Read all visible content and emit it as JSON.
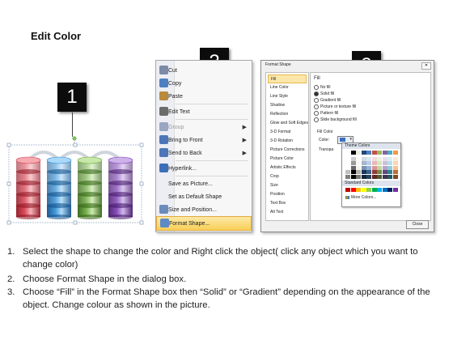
{
  "title": "Edit Color",
  "steps": [
    "1",
    "2",
    "3"
  ],
  "cylinders": {
    "colors": [
      {
        "name": "red",
        "dark": "#8b0f1c",
        "mid": "#d63b4b",
        "light": "#f6aab2"
      },
      {
        "name": "blue",
        "dark": "#0a4a86",
        "mid": "#2f8fd6",
        "light": "#a9d8f8"
      },
      {
        "name": "green",
        "dark": "#2c5e0c",
        "mid": "#6aa83a",
        "light": "#c7e8a8"
      },
      {
        "name": "purple",
        "dark": "#3f1366",
        "mid": "#7d3fb5",
        "light": "#cdb2ea"
      }
    ]
  },
  "context_menu": {
    "items": [
      {
        "label": "Cut",
        "icon": "scissors-icon",
        "color": "#7d8aa8",
        "disabled": false,
        "submenu": false
      },
      {
        "label": "Copy",
        "icon": "copy-icon",
        "color": "#4e7fc0",
        "disabled": false,
        "submenu": false
      },
      {
        "label": "Paste",
        "icon": "paste-icon",
        "color": "#b98a3c",
        "disabled": false,
        "submenu": false
      },
      {
        "label": "Edit Text",
        "icon": "edit-text-icon",
        "color": "#6b6b6b",
        "disabled": false,
        "submenu": false
      },
      {
        "label": "Group",
        "icon": "group-icon",
        "color": "#9aa6c2",
        "disabled": true,
        "submenu": true
      },
      {
        "label": "Bring to Front",
        "icon": "bring-to-front-icon",
        "color": "#4c76b8",
        "disabled": false,
        "submenu": true
      },
      {
        "label": "Send to Back",
        "icon": "send-to-back-icon",
        "color": "#4c76b8",
        "disabled": false,
        "submenu": true
      },
      {
        "label": "Hyperlink...",
        "icon": "hyperlink-icon",
        "color": "#3d6fb8",
        "disabled": false,
        "submenu": false
      },
      {
        "label": "Save as Picture...",
        "icon": "",
        "color": "",
        "disabled": false,
        "submenu": false
      },
      {
        "label": "Set as Default Shape",
        "icon": "",
        "color": "",
        "disabled": false,
        "submenu": false
      },
      {
        "label": "Size and Position...",
        "icon": "size-position-icon",
        "color": "#6c8bbd",
        "disabled": false,
        "submenu": false
      },
      {
        "label": "Format Shape...",
        "icon": "format-shape-icon",
        "color": "#5b8ac6",
        "disabled": false,
        "submenu": false,
        "highlighted": true
      }
    ]
  },
  "format_dialog": {
    "title": "Format Shape",
    "nav": [
      "Fill",
      "Line Color",
      "Line Style",
      "Shadow",
      "Reflection",
      "Glow and Soft Edges",
      "3-D Format",
      "3-D Rotation",
      "Picture Corrections",
      "Picture Color",
      "Artistic Effects",
      "Crop",
      "Size",
      "Position",
      "Text Box",
      "Alt Text"
    ],
    "selected_nav": "Fill",
    "section_heading": "Fill",
    "options": [
      {
        "label": "No fill",
        "selected": false
      },
      {
        "label": "Solid fill",
        "selected": true
      },
      {
        "label": "Gradient fill",
        "selected": false
      },
      {
        "label": "Picture or texture fill",
        "selected": false
      },
      {
        "label": "Pattern fill",
        "selected": false
      },
      {
        "label": "Slide background fill",
        "selected": false
      }
    ],
    "fill_color_label": "Fill Color",
    "color_label": "Color:",
    "transparency_label": "Transpa",
    "theme_colors_label": "Theme Colors",
    "standard_colors_label": "Standard Colors",
    "more_colors_label": "More Colors...",
    "close_label": "Close",
    "theme_top": [
      "#ffffff",
      "#000000",
      "#eeece1",
      "#1f497d",
      "#4f81bd",
      "#c0504d",
      "#9bbb59",
      "#8064a2",
      "#4bacc6",
      "#f79646"
    ],
    "standard_colors": [
      "#c00000",
      "#ff0000",
      "#ffc000",
      "#ffff00",
      "#92d050",
      "#00b050",
      "#00b0f0",
      "#0070c0",
      "#002060",
      "#7030a0"
    ]
  },
  "instructions": [
    {
      "n": "1.",
      "text": "Select the shape to change the color and Right click the object( click any object which you want to change color)"
    },
    {
      "n": "2.",
      "text": "Choose Format Shape in the dialog box."
    },
    {
      "n": "3.",
      "text": "Choose “Fill” in the Format Shape box then “Solid” or “Gradient” depending on the appearance of the object. Change colour as shown in the picture."
    }
  ]
}
